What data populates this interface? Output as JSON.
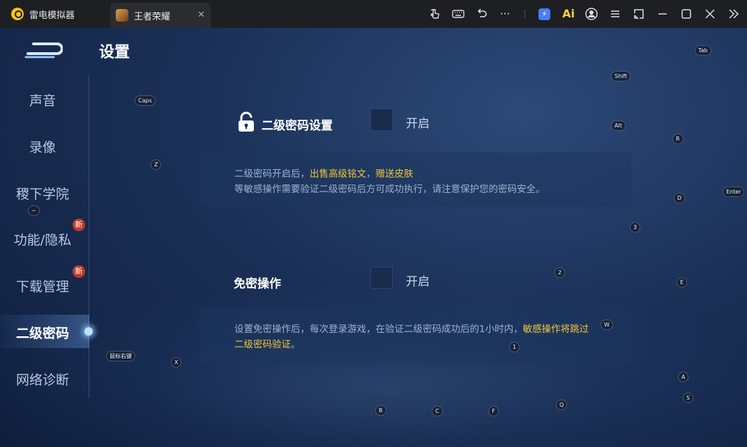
{
  "titlebar": {
    "app_name": "雷电模拟器",
    "game_tab": "王者荣耀",
    "close_glyph": "✕",
    "icons": [
      "gesture-icon",
      "keyboard-icon",
      "undo-icon",
      "more-icon",
      "boost-icon",
      "ai-icon",
      "account-icon",
      "menu-icon",
      "window-mode-icon",
      "minimize-icon",
      "maximize-icon",
      "close-icon",
      "expand-icon"
    ],
    "ai_label": "Ai"
  },
  "page": {
    "title": "设置"
  },
  "sidebar": {
    "items": [
      {
        "label": "声音"
      },
      {
        "label": "录像"
      },
      {
        "label": "稷下学院"
      },
      {
        "label": "功能/隐私",
        "badge": "新"
      },
      {
        "label": "下载管理",
        "badge": "新"
      },
      {
        "label": "二级密码",
        "active": true
      },
      {
        "label": "网络诊断"
      }
    ]
  },
  "settings": {
    "second_password": {
      "label": "二级密码设置",
      "toggle_label": "开启",
      "desc_prefix": "二级密码开启后，",
      "desc_highlight1": "出售高级铭文",
      "desc_sep": "，",
      "desc_highlight2": "赠送皮肤",
      "desc_line2": "等敏感操作需要验证二级密码后方可成功执行，请注意保护您的密码安全。"
    },
    "password_free": {
      "label": "免密操作",
      "toggle_label": "开启",
      "desc_prefix": "设置免密操作后，每次登录游戏，在验证二级密码成功后的1小时内，",
      "desc_highlight": "敏感操作将跳过二级密码验证",
      "desc_suffix": "。"
    }
  },
  "key_hints": {
    "tab": "Tab",
    "shift": "Shift",
    "caps": "Caps",
    "alt": "Alt",
    "r": "R",
    "z": "Z",
    "enter": "Enter",
    "d": "D",
    "tilde": "~",
    "three": "3",
    "two": "2",
    "e": "E",
    "w": "W",
    "one": "1",
    "mouse_left": "鼠标右键",
    "x": "X",
    "a": "A",
    "s": "S",
    "b": "B",
    "c": "C",
    "f": "F",
    "q": "Q"
  },
  "colors": {
    "highlight": "#f0c63a",
    "background": "#1b3057",
    "titlebar": "#1e1f23"
  }
}
